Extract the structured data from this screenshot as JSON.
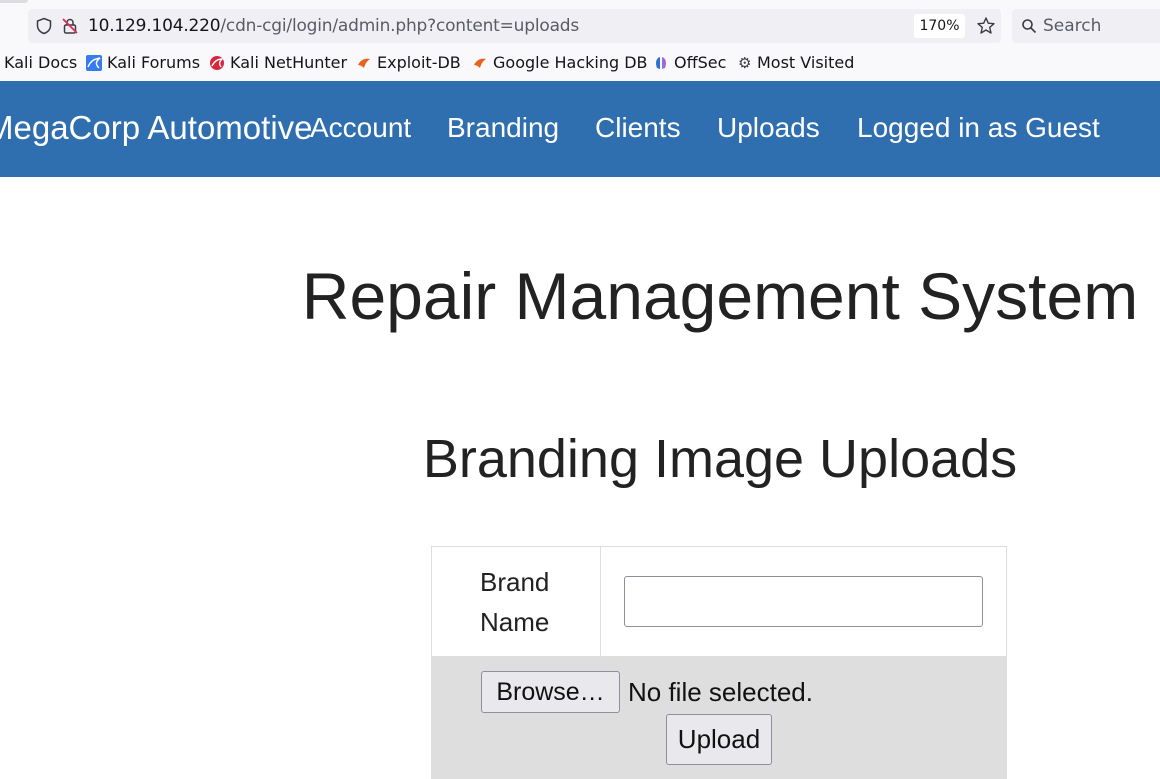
{
  "browser": {
    "url_host": "10.129.104.220",
    "url_path": "/cdn-cgi/login/admin.php?content=uploads",
    "zoom": "170%",
    "search_placeholder": "Search",
    "bookmarks": [
      {
        "label": "Kali Docs",
        "icon": "kali-icon"
      },
      {
        "label": "Kali Forums",
        "icon": "kali-forums-icon"
      },
      {
        "label": "Kali NetHunter",
        "icon": "nethunter-icon"
      },
      {
        "label": "Exploit-DB",
        "icon": "exploit-db-icon"
      },
      {
        "label": "Google Hacking DB",
        "icon": "ghdb-icon"
      },
      {
        "label": "OffSec",
        "icon": "offsec-icon"
      },
      {
        "label": "Most Visited",
        "icon": "gear-icon"
      }
    ]
  },
  "navbar": {
    "brand": "MegaCorp Automotive",
    "links": [
      "Account",
      "Branding",
      "Clients",
      "Uploads",
      "Logged in as Guest"
    ],
    "bg_color": "#2f6fb0"
  },
  "main": {
    "title": "Repair Management System",
    "section_title": "Branding Image Uploads",
    "form": {
      "brand_label": "Brand Name",
      "brand_value": "",
      "browse_label": "Browse…",
      "file_status": "No file selected.",
      "upload_label": "Upload"
    }
  }
}
